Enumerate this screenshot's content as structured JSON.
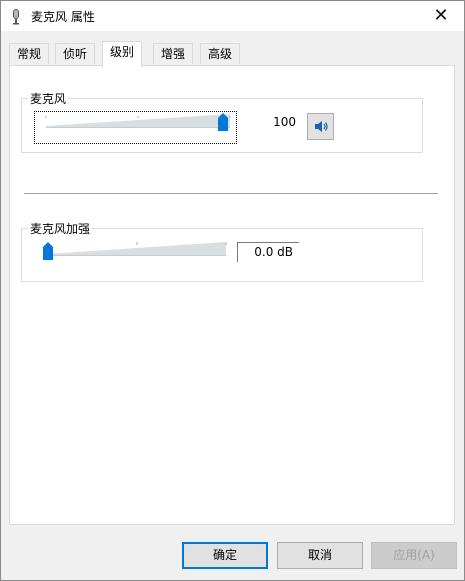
{
  "window": {
    "title": "麦克风 属性",
    "close_label": "✕"
  },
  "tabs": [
    {
      "label": "常规",
      "active": false
    },
    {
      "label": "侦听",
      "active": false
    },
    {
      "label": "级别",
      "active": true
    },
    {
      "label": "增强",
      "active": false
    },
    {
      "label": "高级",
      "active": false
    }
  ],
  "microphone": {
    "label": "麦克风",
    "value_text": "100",
    "level_fraction": 1.0,
    "speaker_icon": "speaker-unmuted-icon"
  },
  "boost": {
    "label": "麦克风加强",
    "value_text": "0.0 dB",
    "level_fraction": 0.0
  },
  "buttons": {
    "ok": "确定",
    "cancel": "取消",
    "apply": "应用(A)"
  },
  "colors": {
    "accent": "#0078d7",
    "track": "#d8dfe3"
  }
}
